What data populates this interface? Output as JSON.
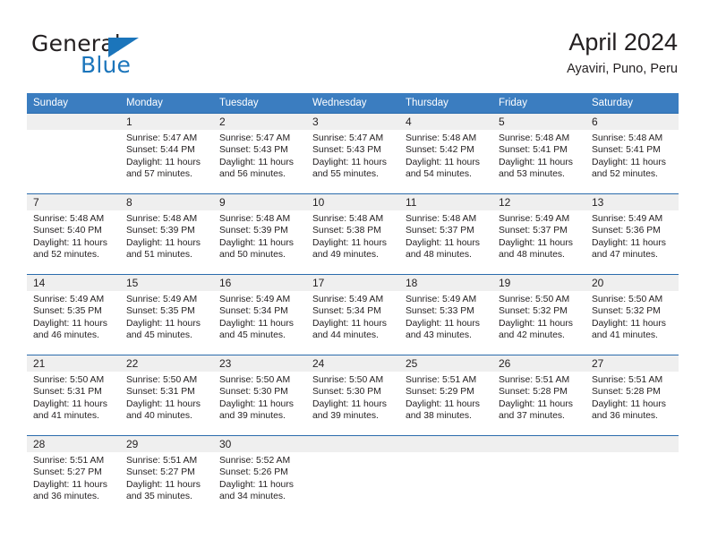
{
  "brand": {
    "name_part1": "General",
    "name_part2": "Blue",
    "accent_color": "#1b75bb"
  },
  "header": {
    "title": "April 2024",
    "subtitle": "Ayaviri, Puno, Peru"
  },
  "theme": {
    "header_band": "#3b7dc0",
    "week_separator": "#2b6cad",
    "daynum_band": "#efefef",
    "text": "#231f20"
  },
  "weekday_headers": [
    "Sunday",
    "Monday",
    "Tuesday",
    "Wednesday",
    "Thursday",
    "Friday",
    "Saturday"
  ],
  "weeks": [
    {
      "days": [
        {
          "date": "",
          "sunrise": "",
          "sunset": "",
          "daylight_line1": "",
          "daylight_line2": ""
        },
        {
          "date": "1",
          "sunrise": "Sunrise: 5:47 AM",
          "sunset": "Sunset: 5:44 PM",
          "daylight_line1": "Daylight: 11 hours",
          "daylight_line2": "and 57 minutes."
        },
        {
          "date": "2",
          "sunrise": "Sunrise: 5:47 AM",
          "sunset": "Sunset: 5:43 PM",
          "daylight_line1": "Daylight: 11 hours",
          "daylight_line2": "and 56 minutes."
        },
        {
          "date": "3",
          "sunrise": "Sunrise: 5:47 AM",
          "sunset": "Sunset: 5:43 PM",
          "daylight_line1": "Daylight: 11 hours",
          "daylight_line2": "and 55 minutes."
        },
        {
          "date": "4",
          "sunrise": "Sunrise: 5:48 AM",
          "sunset": "Sunset: 5:42 PM",
          "daylight_line1": "Daylight: 11 hours",
          "daylight_line2": "and 54 minutes."
        },
        {
          "date": "5",
          "sunrise": "Sunrise: 5:48 AM",
          "sunset": "Sunset: 5:41 PM",
          "daylight_line1": "Daylight: 11 hours",
          "daylight_line2": "and 53 minutes."
        },
        {
          "date": "6",
          "sunrise": "Sunrise: 5:48 AM",
          "sunset": "Sunset: 5:41 PM",
          "daylight_line1": "Daylight: 11 hours",
          "daylight_line2": "and 52 minutes."
        }
      ]
    },
    {
      "days": [
        {
          "date": "7",
          "sunrise": "Sunrise: 5:48 AM",
          "sunset": "Sunset: 5:40 PM",
          "daylight_line1": "Daylight: 11 hours",
          "daylight_line2": "and 52 minutes."
        },
        {
          "date": "8",
          "sunrise": "Sunrise: 5:48 AM",
          "sunset": "Sunset: 5:39 PM",
          "daylight_line1": "Daylight: 11 hours",
          "daylight_line2": "and 51 minutes."
        },
        {
          "date": "9",
          "sunrise": "Sunrise: 5:48 AM",
          "sunset": "Sunset: 5:39 PM",
          "daylight_line1": "Daylight: 11 hours",
          "daylight_line2": "and 50 minutes."
        },
        {
          "date": "10",
          "sunrise": "Sunrise: 5:48 AM",
          "sunset": "Sunset: 5:38 PM",
          "daylight_line1": "Daylight: 11 hours",
          "daylight_line2": "and 49 minutes."
        },
        {
          "date": "11",
          "sunrise": "Sunrise: 5:48 AM",
          "sunset": "Sunset: 5:37 PM",
          "daylight_line1": "Daylight: 11 hours",
          "daylight_line2": "and 48 minutes."
        },
        {
          "date": "12",
          "sunrise": "Sunrise: 5:49 AM",
          "sunset": "Sunset: 5:37 PM",
          "daylight_line1": "Daylight: 11 hours",
          "daylight_line2": "and 48 minutes."
        },
        {
          "date": "13",
          "sunrise": "Sunrise: 5:49 AM",
          "sunset": "Sunset: 5:36 PM",
          "daylight_line1": "Daylight: 11 hours",
          "daylight_line2": "and 47 minutes."
        }
      ]
    },
    {
      "days": [
        {
          "date": "14",
          "sunrise": "Sunrise: 5:49 AM",
          "sunset": "Sunset: 5:35 PM",
          "daylight_line1": "Daylight: 11 hours",
          "daylight_line2": "and 46 minutes."
        },
        {
          "date": "15",
          "sunrise": "Sunrise: 5:49 AM",
          "sunset": "Sunset: 5:35 PM",
          "daylight_line1": "Daylight: 11 hours",
          "daylight_line2": "and 45 minutes."
        },
        {
          "date": "16",
          "sunrise": "Sunrise: 5:49 AM",
          "sunset": "Sunset: 5:34 PM",
          "daylight_line1": "Daylight: 11 hours",
          "daylight_line2": "and 45 minutes."
        },
        {
          "date": "17",
          "sunrise": "Sunrise: 5:49 AM",
          "sunset": "Sunset: 5:34 PM",
          "daylight_line1": "Daylight: 11 hours",
          "daylight_line2": "and 44 minutes."
        },
        {
          "date": "18",
          "sunrise": "Sunrise: 5:49 AM",
          "sunset": "Sunset: 5:33 PM",
          "daylight_line1": "Daylight: 11 hours",
          "daylight_line2": "and 43 minutes."
        },
        {
          "date": "19",
          "sunrise": "Sunrise: 5:50 AM",
          "sunset": "Sunset: 5:32 PM",
          "daylight_line1": "Daylight: 11 hours",
          "daylight_line2": "and 42 minutes."
        },
        {
          "date": "20",
          "sunrise": "Sunrise: 5:50 AM",
          "sunset": "Sunset: 5:32 PM",
          "daylight_line1": "Daylight: 11 hours",
          "daylight_line2": "and 41 minutes."
        }
      ]
    },
    {
      "days": [
        {
          "date": "21",
          "sunrise": "Sunrise: 5:50 AM",
          "sunset": "Sunset: 5:31 PM",
          "daylight_line1": "Daylight: 11 hours",
          "daylight_line2": "and 41 minutes."
        },
        {
          "date": "22",
          "sunrise": "Sunrise: 5:50 AM",
          "sunset": "Sunset: 5:31 PM",
          "daylight_line1": "Daylight: 11 hours",
          "daylight_line2": "and 40 minutes."
        },
        {
          "date": "23",
          "sunrise": "Sunrise: 5:50 AM",
          "sunset": "Sunset: 5:30 PM",
          "daylight_line1": "Daylight: 11 hours",
          "daylight_line2": "and 39 minutes."
        },
        {
          "date": "24",
          "sunrise": "Sunrise: 5:50 AM",
          "sunset": "Sunset: 5:30 PM",
          "daylight_line1": "Daylight: 11 hours",
          "daylight_line2": "and 39 minutes."
        },
        {
          "date": "25",
          "sunrise": "Sunrise: 5:51 AM",
          "sunset": "Sunset: 5:29 PM",
          "daylight_line1": "Daylight: 11 hours",
          "daylight_line2": "and 38 minutes."
        },
        {
          "date": "26",
          "sunrise": "Sunrise: 5:51 AM",
          "sunset": "Sunset: 5:28 PM",
          "daylight_line1": "Daylight: 11 hours",
          "daylight_line2": "and 37 minutes."
        },
        {
          "date": "27",
          "sunrise": "Sunrise: 5:51 AM",
          "sunset": "Sunset: 5:28 PM",
          "daylight_line1": "Daylight: 11 hours",
          "daylight_line2": "and 36 minutes."
        }
      ]
    },
    {
      "days": [
        {
          "date": "28",
          "sunrise": "Sunrise: 5:51 AM",
          "sunset": "Sunset: 5:27 PM",
          "daylight_line1": "Daylight: 11 hours",
          "daylight_line2": "and 36 minutes."
        },
        {
          "date": "29",
          "sunrise": "Sunrise: 5:51 AM",
          "sunset": "Sunset: 5:27 PM",
          "daylight_line1": "Daylight: 11 hours",
          "daylight_line2": "and 35 minutes."
        },
        {
          "date": "30",
          "sunrise": "Sunrise: 5:52 AM",
          "sunset": "Sunset: 5:26 PM",
          "daylight_line1": "Daylight: 11 hours",
          "daylight_line2": "and 34 minutes."
        },
        {
          "date": "",
          "sunrise": "",
          "sunset": "",
          "daylight_line1": "",
          "daylight_line2": ""
        },
        {
          "date": "",
          "sunrise": "",
          "sunset": "",
          "daylight_line1": "",
          "daylight_line2": ""
        },
        {
          "date": "",
          "sunrise": "",
          "sunset": "",
          "daylight_line1": "",
          "daylight_line2": ""
        },
        {
          "date": "",
          "sunrise": "",
          "sunset": "",
          "daylight_line1": "",
          "daylight_line2": ""
        }
      ]
    }
  ]
}
